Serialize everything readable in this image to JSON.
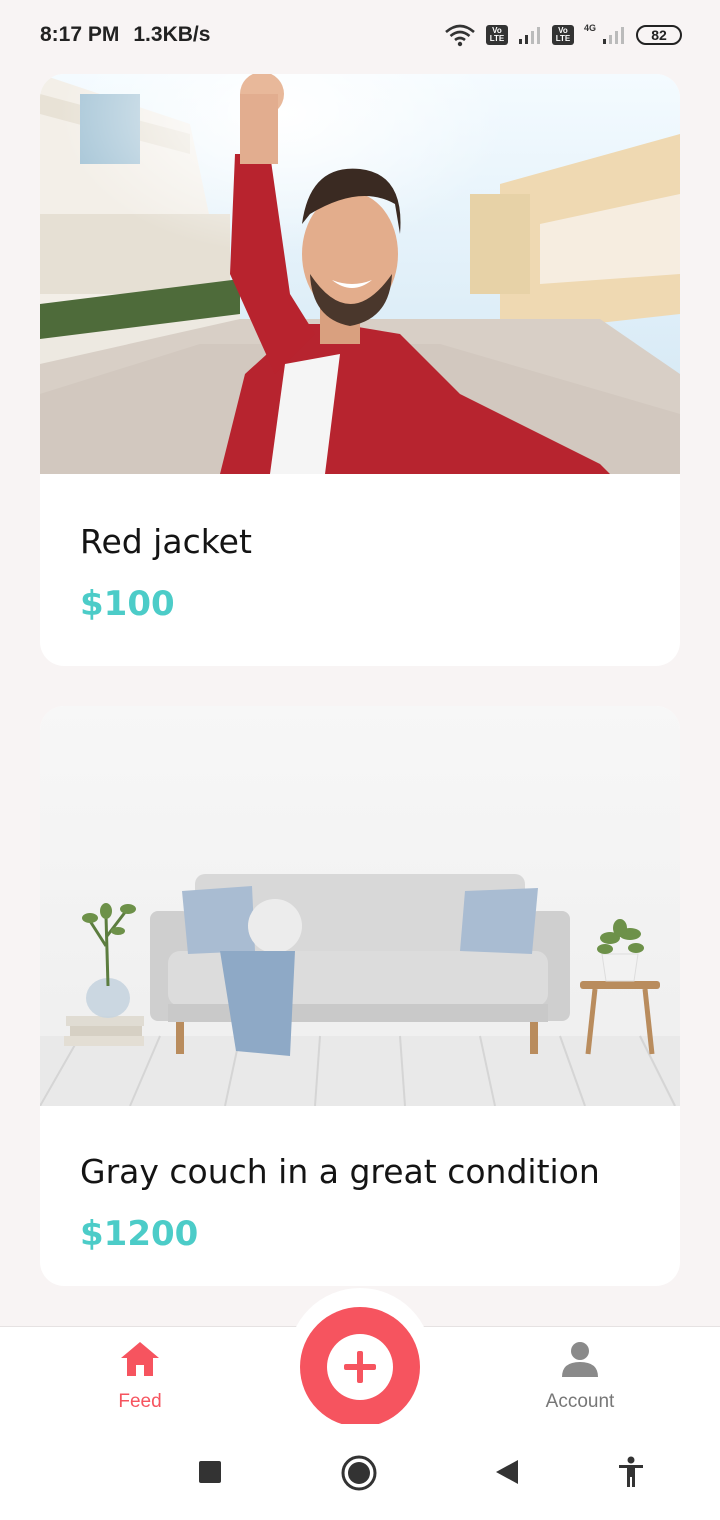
{
  "status_bar": {
    "time": "8:17 PM",
    "speed": "1.3KB/s",
    "volte_label": "Vo LTE",
    "network_type": "4G",
    "battery": "82"
  },
  "listings": [
    {
      "title": "Red jacket",
      "price": "$100",
      "image": "man-red-jacket-photo"
    },
    {
      "title": "Gray couch in a great condition",
      "price": "$1200",
      "image": "gray-couch-photo"
    }
  ],
  "bottom_nav": {
    "feed_label": "Feed",
    "account_label": "Account",
    "add_icon": "plus-icon"
  },
  "colors": {
    "accent": "#f6545f",
    "price": "#4cccc8",
    "background": "#f8f4f4"
  }
}
